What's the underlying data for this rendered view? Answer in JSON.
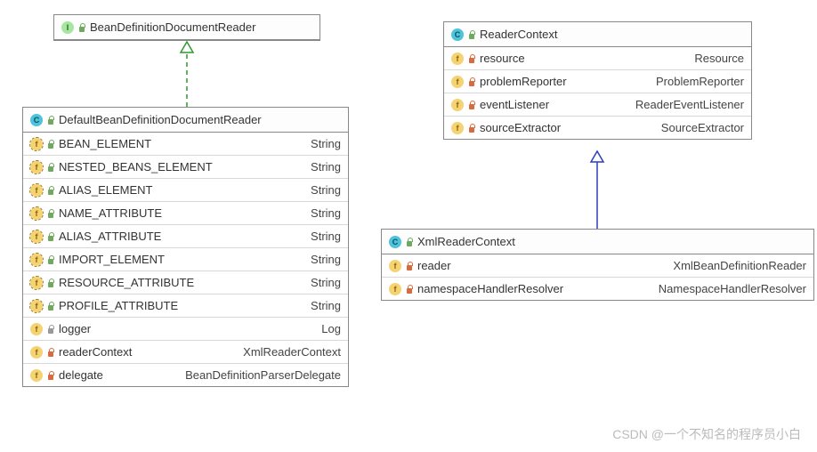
{
  "interface_box": {
    "title": "BeanDefinitionDocumentReader"
  },
  "class_box": {
    "title": "DefaultBeanDefinitionDocumentReader",
    "rows": [
      {
        "name": "BEAN_ELEMENT",
        "type": "String",
        "static": true,
        "vis": "green"
      },
      {
        "name": "NESTED_BEANS_ELEMENT",
        "type": "String",
        "static": true,
        "vis": "green"
      },
      {
        "name": "ALIAS_ELEMENT",
        "type": "String",
        "static": true,
        "vis": "green"
      },
      {
        "name": "NAME_ATTRIBUTE",
        "type": "String",
        "static": true,
        "vis": "green"
      },
      {
        "name": "ALIAS_ATTRIBUTE",
        "type": "String",
        "static": true,
        "vis": "green"
      },
      {
        "name": "IMPORT_ELEMENT",
        "type": "String",
        "static": true,
        "vis": "green"
      },
      {
        "name": "RESOURCE_ATTRIBUTE",
        "type": "String",
        "static": true,
        "vis": "green"
      },
      {
        "name": "PROFILE_ATTRIBUTE",
        "type": "String",
        "static": true,
        "vis": "green"
      },
      {
        "name": "logger",
        "type": "Log",
        "static": false,
        "vis": "grey"
      },
      {
        "name": "readerContext",
        "type": "XmlReaderContext",
        "static": false,
        "vis": "red"
      },
      {
        "name": "delegate",
        "type": "BeanDefinitionParserDelegate",
        "static": false,
        "vis": "red"
      }
    ]
  },
  "reader_context_box": {
    "title": "ReaderContext",
    "rows": [
      {
        "name": "resource",
        "type": "Resource",
        "vis": "red"
      },
      {
        "name": "problemReporter",
        "type": "ProblemReporter",
        "vis": "red"
      },
      {
        "name": "eventListener",
        "type": "ReaderEventListener",
        "vis": "red"
      },
      {
        "name": "sourceExtractor",
        "type": "SourceExtractor",
        "vis": "red"
      }
    ]
  },
  "xml_reader_context_box": {
    "title": "XmlReaderContext",
    "rows": [
      {
        "name": "reader",
        "type": "XmlBeanDefinitionReader",
        "vis": "red"
      },
      {
        "name": "namespaceHandlerResolver",
        "type": "NamespaceHandlerResolver",
        "vis": "red"
      }
    ]
  },
  "watermark": "CSDN @一个不知名的程序员小白"
}
